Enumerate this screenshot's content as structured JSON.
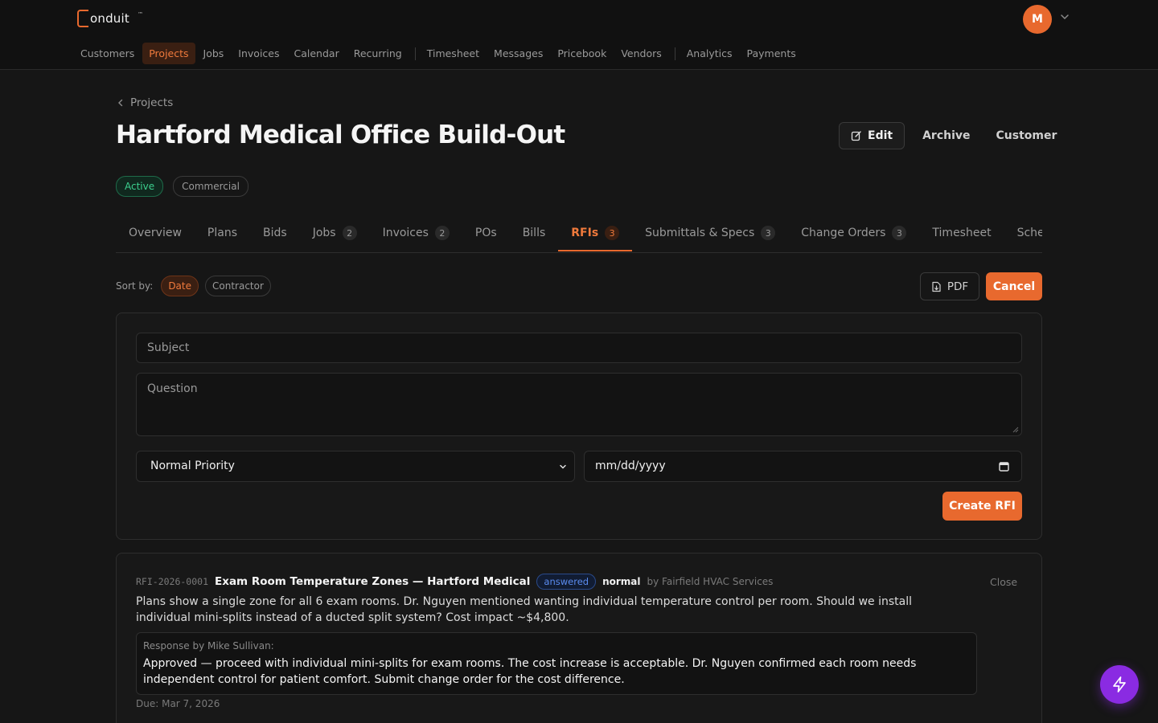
{
  "brand": {
    "name": "onduit",
    "tm": "™",
    "accent": "#e8692e"
  },
  "user": {
    "initial": "M"
  },
  "nav": {
    "items": [
      {
        "label": "Customers"
      },
      {
        "label": "Projects"
      },
      {
        "label": "Jobs"
      },
      {
        "label": "Invoices"
      },
      {
        "label": "Calendar"
      },
      {
        "label": "Recurring"
      },
      {
        "label": "Timesheet"
      },
      {
        "label": "Messages"
      },
      {
        "label": "Pricebook"
      },
      {
        "label": "Vendors"
      },
      {
        "label": "Analytics"
      },
      {
        "label": "Payments"
      }
    ],
    "active": "Projects"
  },
  "breadcrumb": {
    "label": "Projects"
  },
  "project": {
    "title": "Hartford Medical Office Build-Out",
    "status": "Active",
    "type": "Commercial"
  },
  "actions": {
    "edit": "Edit",
    "archive": "Archive",
    "customer": "Customer"
  },
  "tabs": [
    {
      "label": "Overview",
      "count": ""
    },
    {
      "label": "Plans",
      "count": ""
    },
    {
      "label": "Bids",
      "count": ""
    },
    {
      "label": "Jobs",
      "count": "2"
    },
    {
      "label": "Invoices",
      "count": "2"
    },
    {
      "label": "POs",
      "count": ""
    },
    {
      "label": "Bills",
      "count": ""
    },
    {
      "label": "RFIs",
      "count": "3"
    },
    {
      "label": "Submittals & Specs",
      "count": "3"
    },
    {
      "label": "Change Orders",
      "count": "3"
    },
    {
      "label": "Timesheet",
      "count": ""
    },
    {
      "label": "Sche",
      "count": ""
    }
  ],
  "active_tab": "RFIs",
  "sort": {
    "label": "Sort by:",
    "options": [
      "Date",
      "Contractor"
    ],
    "selected": "Date"
  },
  "toolbar": {
    "pdf": "PDF",
    "cancel": "Cancel"
  },
  "form": {
    "subject_placeholder": "Subject",
    "question_placeholder": "Question",
    "priority_value": "Normal Priority",
    "date_placeholder": "mm/dd/yyyy",
    "submit": "Create RFI"
  },
  "rfi": {
    "id": "RFI-2026-0001",
    "title": "Exam Room Temperature Zones — Hartford Medical",
    "status": "answered",
    "priority": "normal",
    "by": "by Fairfield HVAC Services",
    "close": "Close",
    "question": "Plans show a single zone for all 6 exam rooms. Dr. Nguyen mentioned wanting individual temperature control per room. Should we install individual mini-splits instead of a ducted split system? Cost impact ~$4,800.",
    "response_label": "Response by Mike Sullivan:",
    "response": "Approved — proceed with individual mini-splits for exam rooms. The cost increase is acceptable. Dr. Nguyen confirmed each room needs independent control for patient comfort. Submit change order for the cost difference.",
    "due": "Due: Mar 7, 2026"
  },
  "fab": {
    "icon": "bolt-icon",
    "color": "#8a2be2"
  }
}
